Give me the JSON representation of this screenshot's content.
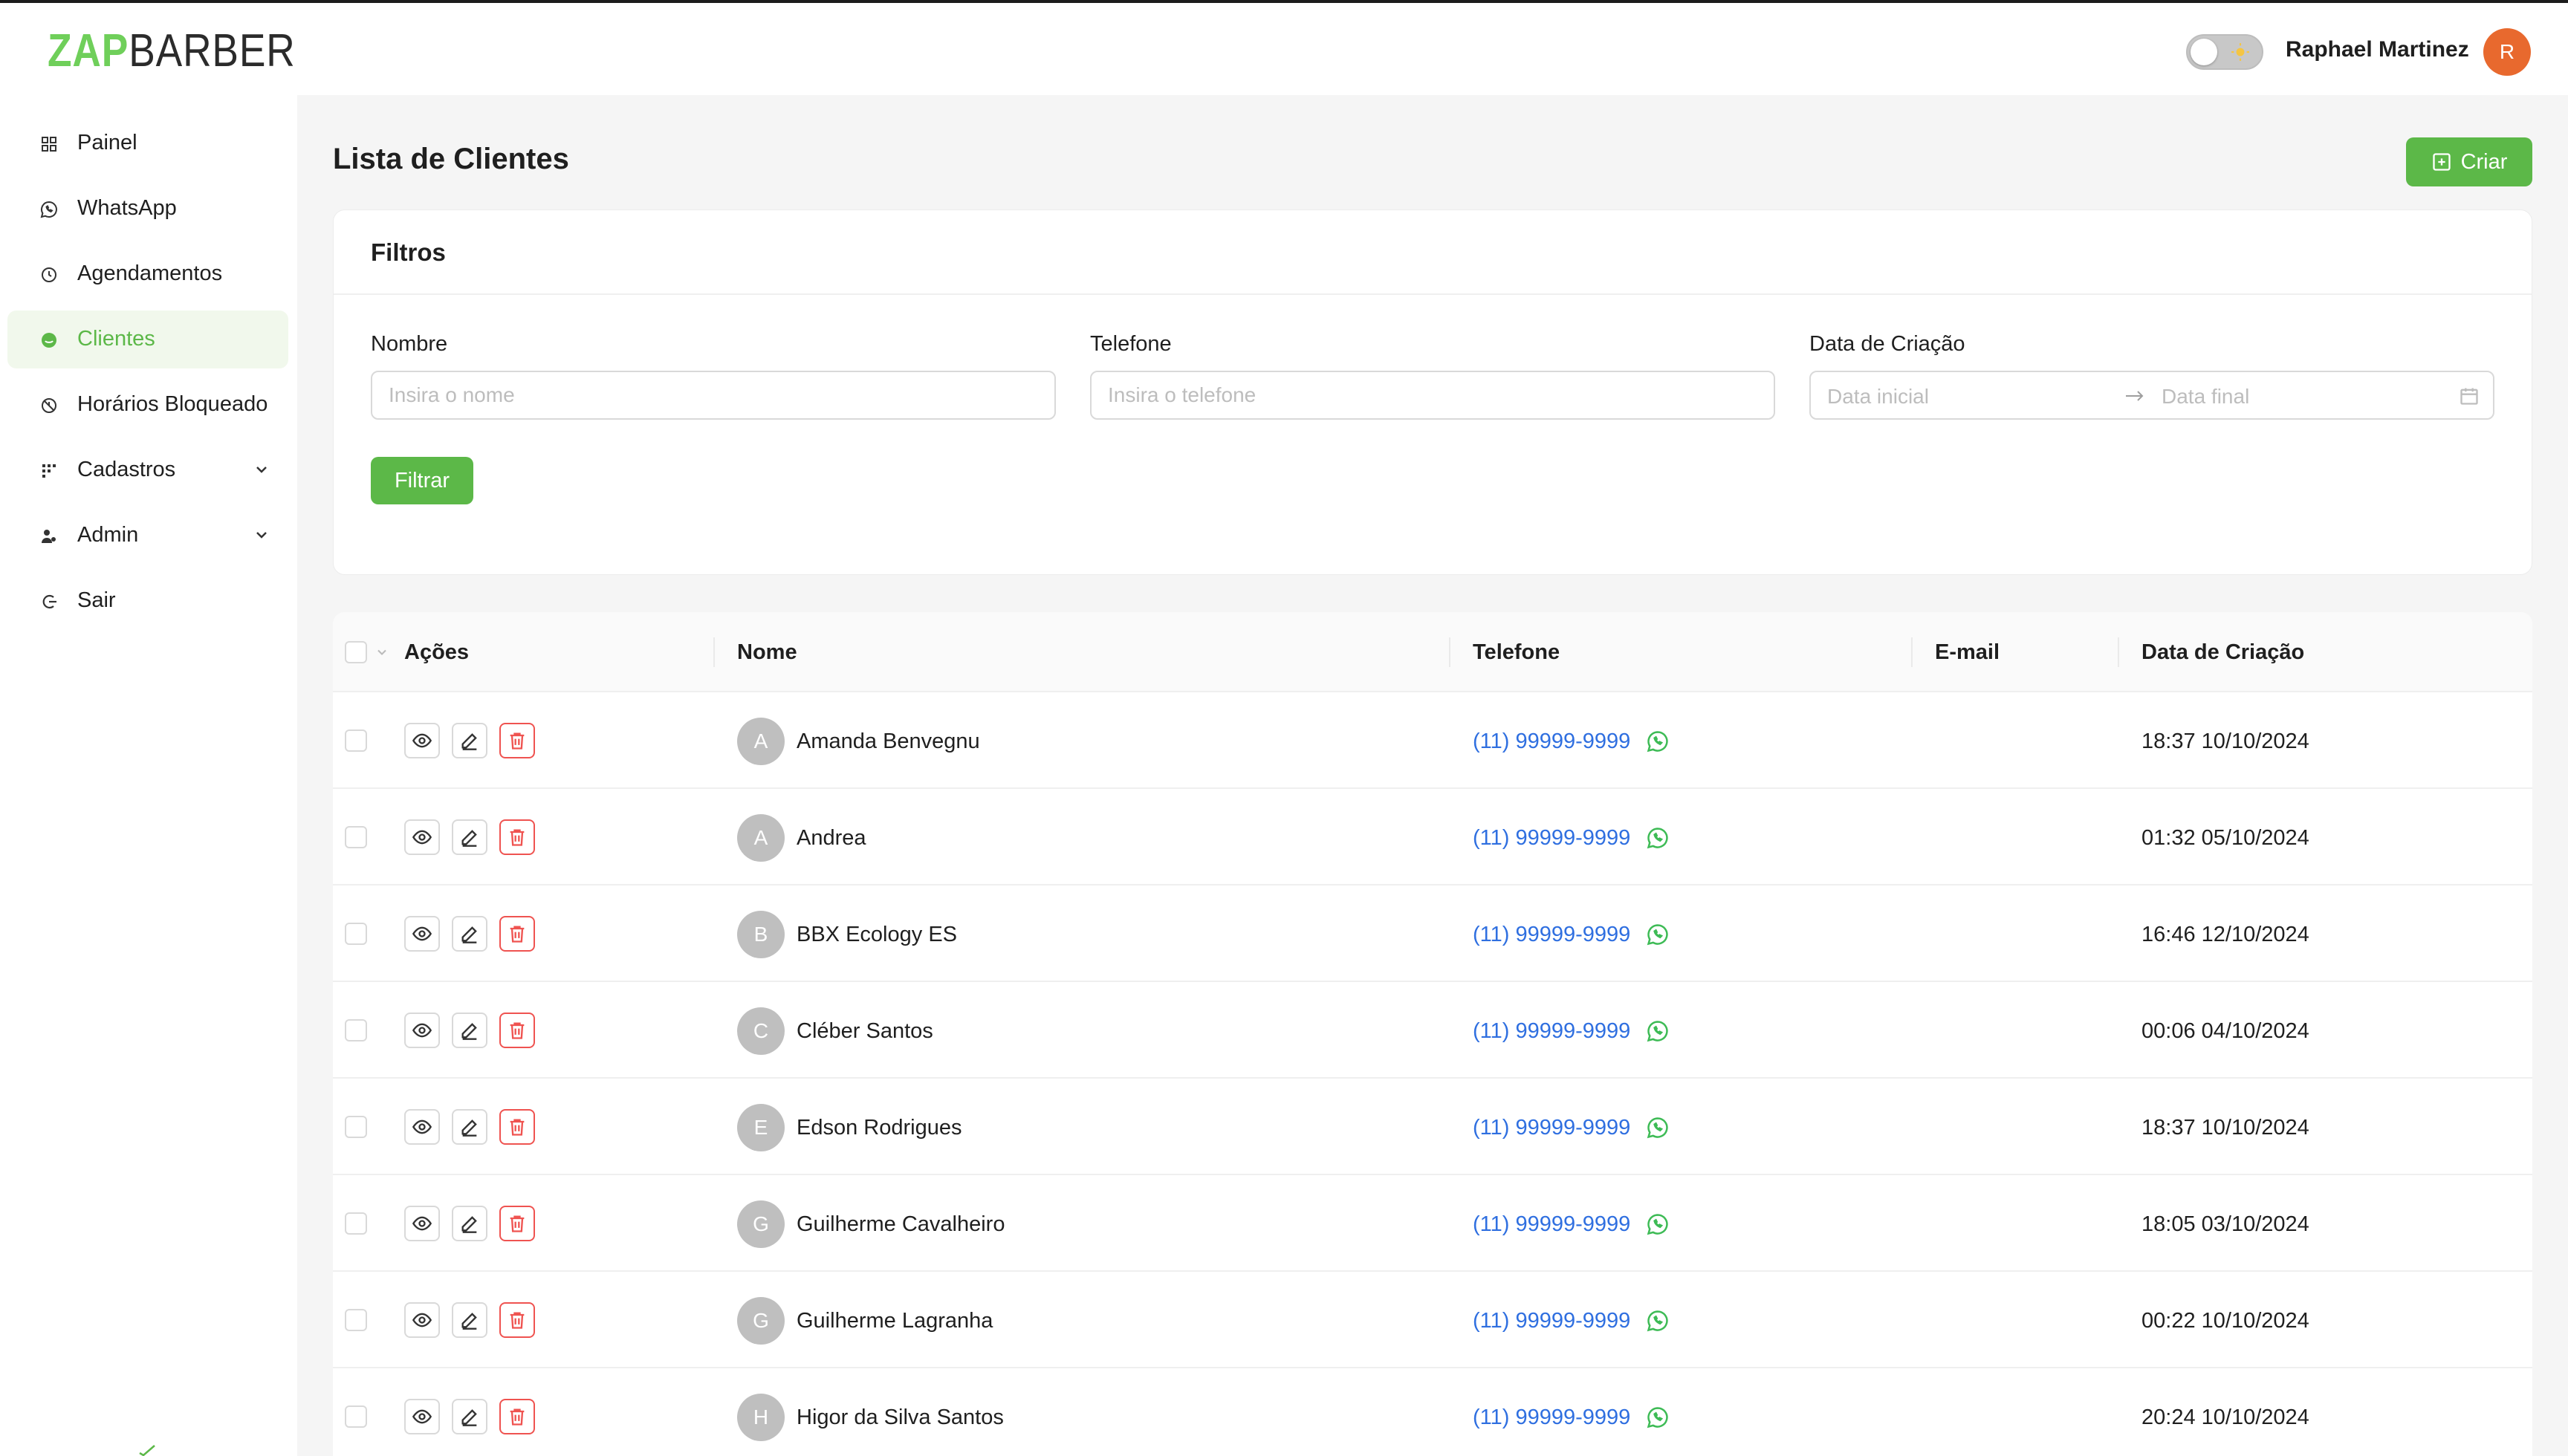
{
  "brand": {
    "part1": "ZAP",
    "part2": "BARBER"
  },
  "header": {
    "user_name": "Raphael Martinez",
    "user_initial": "R"
  },
  "sidebar": {
    "items": [
      {
        "label": "Painel",
        "icon": "dashboard-icon"
      },
      {
        "label": "WhatsApp",
        "icon": "whatsapp-icon"
      },
      {
        "label": "Agendamentos",
        "icon": "clock-icon"
      },
      {
        "label": "Clientes",
        "icon": "client-icon",
        "active": true
      },
      {
        "label": "Horários Bloqueado",
        "icon": "blocked-hours-icon"
      },
      {
        "label": "Cadastros",
        "icon": "registers-icon",
        "expandable": true
      },
      {
        "label": "Admin",
        "icon": "admin-icon",
        "expandable": true
      },
      {
        "label": "Sair",
        "icon": "logout-icon"
      }
    ]
  },
  "page": {
    "title": "Lista de Clientes",
    "create_label": "Criar"
  },
  "filters": {
    "title": "Filtros",
    "name_label": "Nombre",
    "name_placeholder": "Insira o nome",
    "phone_label": "Telefone",
    "phone_placeholder": "Insira o telefone",
    "date_label": "Data de Criação",
    "date_start_placeholder": "Data inicial",
    "date_end_placeholder": "Data final",
    "filter_label": "Filtrar"
  },
  "table": {
    "headers": {
      "actions": "Ações",
      "name": "Nome",
      "phone": "Telefone",
      "email": "E-mail",
      "created": "Data de Criação"
    },
    "rows": [
      {
        "initial": "A",
        "name": "Amanda Benvegnu",
        "phone": "(11) 99999-9999",
        "email": "",
        "created": "18:37 10/10/2024"
      },
      {
        "initial": "A",
        "name": "Andrea",
        "phone": "(11) 99999-9999",
        "email": "",
        "created": "01:32 05/10/2024"
      },
      {
        "initial": "B",
        "name": "BBX Ecology ES",
        "phone": "(11) 99999-9999",
        "email": "",
        "created": "16:46 12/10/2024"
      },
      {
        "initial": "C",
        "name": "Cléber Santos",
        "phone": "(11) 99999-9999",
        "email": "",
        "created": "00:06 04/10/2024"
      },
      {
        "initial": "E",
        "name": "Edson Rodrigues",
        "phone": "(11) 99999-9999",
        "email": "",
        "created": "18:37 10/10/2024"
      },
      {
        "initial": "G",
        "name": "Guilherme Cavalheiro",
        "phone": "(11) 99999-9999",
        "email": "",
        "created": "18:05 03/10/2024"
      },
      {
        "initial": "G",
        "name": "Guilherme Lagranha",
        "phone": "(11) 99999-9999",
        "email": "",
        "created": "00:22 10/10/2024"
      },
      {
        "initial": "H",
        "name": "Higor da Silva Santos",
        "phone": "(11) 99999-9999",
        "email": "",
        "created": "20:24 10/10/2024"
      }
    ]
  },
  "colors": {
    "accent": "#5cb848",
    "link": "#2f6fe0",
    "danger": "#ef5350",
    "user_avatar": "#e8692e"
  }
}
